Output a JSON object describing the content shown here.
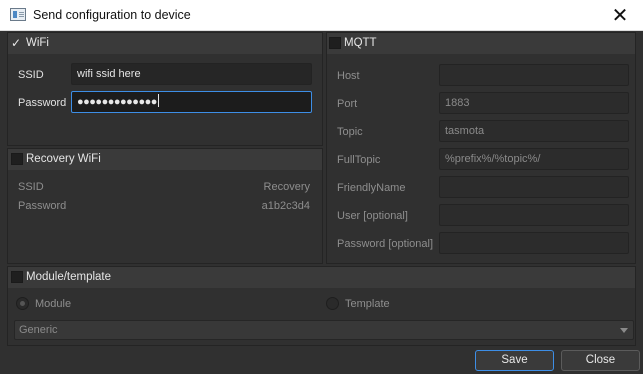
{
  "window": {
    "title": "Send configuration to device",
    "icon": "app-icon",
    "close_glyph": "✕"
  },
  "wifi": {
    "label": "WiFi",
    "checked": true,
    "ssid_label": "SSID",
    "ssid_value": "wifi ssid here",
    "password_label": "Password",
    "password_value": "●●●●●●●●●●●●●"
  },
  "recovery": {
    "label": "Recovery WiFi",
    "checked": false,
    "ssid_label": "SSID",
    "ssid_value": "Recovery",
    "password_label": "Password",
    "password_value": "a1b2c3d4"
  },
  "mqtt": {
    "label": "MQTT",
    "checked": false,
    "host_label": "Host",
    "host_value": "",
    "port_label": "Port",
    "port_value": "1883",
    "topic_label": "Topic",
    "topic_value": "tasmota",
    "fulltopic_label": "FullTopic",
    "fulltopic_value": "%prefix%/%topic%/",
    "friendlyname_label": "FriendlyName",
    "friendlyname_value": "",
    "user_label": "User [optional]",
    "user_value": "",
    "password_label": "Password [optional]",
    "password_value": ""
  },
  "module": {
    "label": "Module/template",
    "checked": false,
    "module_option": "Module",
    "template_option": "Template",
    "selected_option": "Module",
    "select_value": "Generic"
  },
  "buttons": {
    "save": "Save",
    "close": "Close"
  },
  "colors": {
    "background": "#303030",
    "accent": "#3d8ee6"
  }
}
